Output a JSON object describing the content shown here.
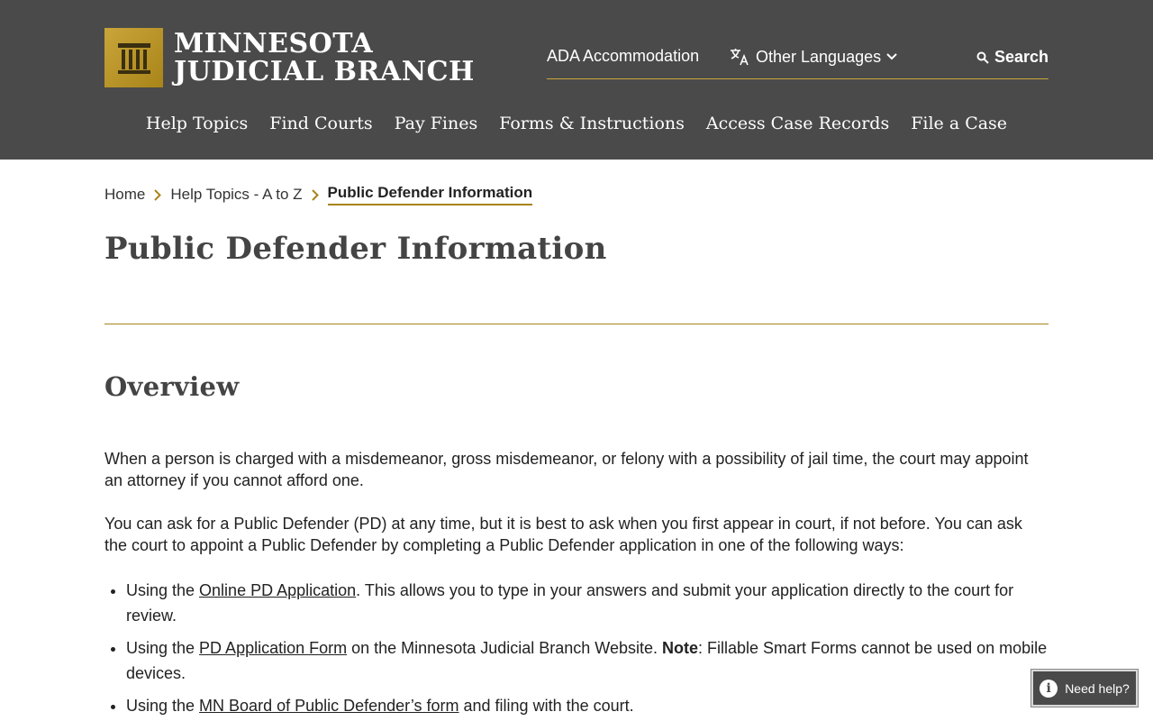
{
  "brand": {
    "line1": "MINNESOTA",
    "line2": "JUDICIAL BRANCH",
    "accent": "#c9a53a",
    "header_bg": "#4a4a4a"
  },
  "utility": {
    "ada": "ADA Accommodation",
    "languages": "Other Languages",
    "search": "Search"
  },
  "nav": {
    "items": [
      "Help Topics",
      "Find Courts",
      "Pay Fines",
      "Forms & Instructions",
      "Access Case Records",
      "File a Case"
    ]
  },
  "breadcrumb": {
    "home": "Home",
    "topics": "Help Topics - A to Z",
    "current": "Public Defender Information"
  },
  "page": {
    "title": "Public Defender Information",
    "section": "Overview"
  },
  "body": {
    "p1": "When a person is charged with a misdemeanor, gross misdemeanor, or felony with a possibility of jail time, the court may appoint an attorney if you cannot afford one.",
    "p2": "You can ask for a Public Defender (PD) at any time, but it is best to ask when you first appear in court, if not before. You can ask the court to appoint a Public Defender by completing a Public Defender application in one of the following ways:",
    "items": [
      {
        "pre": "Using the ",
        "link": "Online PD Application",
        "post": ". This allows you to type in your answers and submit your application directly to the court for review."
      },
      {
        "pre": "Using the ",
        "link": "PD Application Form",
        "mid": " on the Minnesota Judicial Branch Website. ",
        "bold": "Note",
        "post": ": Fillable Smart Forms cannot be used on mobile devices."
      },
      {
        "pre": "Using the ",
        "link": "MN Board of Public Defender’s form",
        "post": " and filing with the court."
      }
    ]
  },
  "help": {
    "label": "Need help?"
  }
}
